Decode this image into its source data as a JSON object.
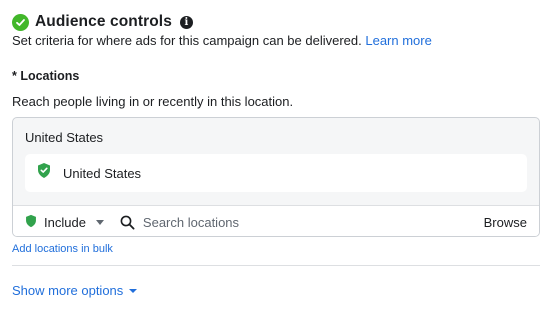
{
  "header": {
    "title": "Audience controls",
    "status_icon": "check-circle-icon",
    "info_icon": "info-icon"
  },
  "subtitle": {
    "text": "Set criteria for where ads for this campaign can be delivered.",
    "link": "Learn more"
  },
  "locations": {
    "label": "* Locations",
    "description": "Reach people living in or recently in this location.",
    "group_title": "United States",
    "selected": [
      "United States"
    ],
    "include_label": "Include",
    "search_placeholder": "Search locations",
    "browse_label": "Browse",
    "bulk_link": "Add locations in bulk"
  },
  "show_more": "Show more options",
  "colors": {
    "accent": "#216fdb",
    "success": "#42b72a",
    "pin": "#31a24c"
  }
}
